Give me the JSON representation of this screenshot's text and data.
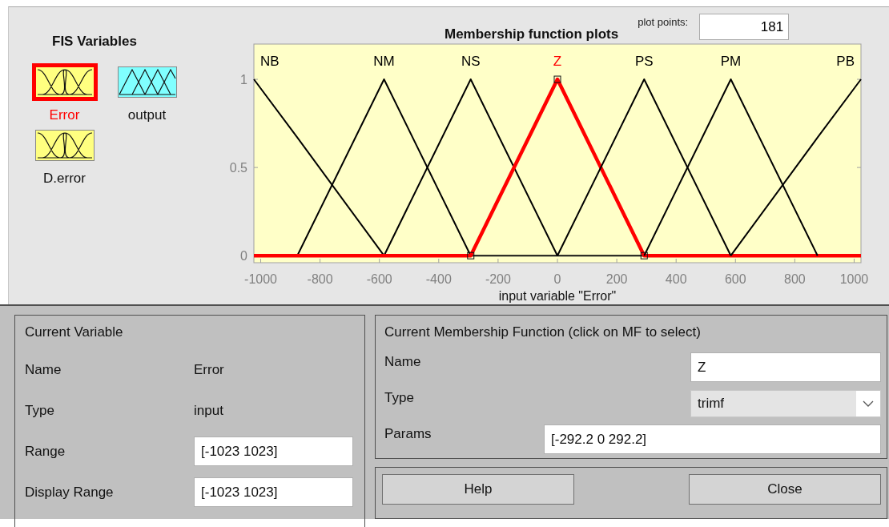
{
  "fis_variables": {
    "title": "FIS Variables",
    "items": [
      {
        "name": "Error",
        "kind": "input",
        "selected": true
      },
      {
        "name": "output",
        "kind": "output",
        "selected": false
      },
      {
        "name": "D.error",
        "kind": "input",
        "selected": false
      }
    ]
  },
  "plot": {
    "plot_points_label": "plot points:",
    "plot_points": "181",
    "membership_functions": [
      {
        "selected": false
      },
      {
        "selected": false
      },
      {
        "selected": false
      },
      {
        "selected": true
      },
      {
        "selected": false
      },
      {
        "selected": false
      },
      {
        "selected": false
      }
    ],
    "chart_data": {
      "type": "line",
      "title": "Membership function plots",
      "xlabel": "input variable \"Error\"",
      "x": [
        -1023,
        -876.6,
        -584.4,
        -292.2,
        0,
        292.2,
        584.4,
        876.6,
        1023
      ],
      "series": [
        {
          "name": "NB",
          "color": "#000000",
          "values": [
            1,
            0.67,
            0,
            null,
            null,
            null,
            null,
            null,
            null
          ]
        },
        {
          "name": "NM",
          "color": "#000000",
          "values": [
            null,
            0,
            1,
            0,
            null,
            null,
            null,
            null,
            null
          ]
        },
        {
          "name": "NS",
          "color": "#000000",
          "values": [
            null,
            null,
            0,
            1,
            0,
            null,
            null,
            null,
            null
          ]
        },
        {
          "name": "Z",
          "color": "#ff0000",
          "values": [
            0,
            0,
            0,
            0,
            1,
            0,
            0,
            0,
            0
          ]
        },
        {
          "name": "PS",
          "color": "#000000",
          "values": [
            null,
            null,
            null,
            null,
            0,
            1,
            0,
            null,
            null
          ]
        },
        {
          "name": "PM",
          "color": "#000000",
          "values": [
            null,
            null,
            null,
            null,
            null,
            0,
            1,
            0,
            null
          ]
        },
        {
          "name": "PB",
          "color": "#000000",
          "values": [
            null,
            null,
            null,
            null,
            null,
            null,
            0,
            0.67,
            1
          ]
        }
      ],
      "legend": "inside-top",
      "xlim": [
        -1023,
        1023
      ],
      "ylim": [
        -0.04,
        1.2
      ],
      "xticks": [
        -1000,
        -800,
        -600,
        -400,
        -200,
        0,
        200,
        400,
        600,
        800,
        1000
      ],
      "yticks": [
        0,
        0.5,
        1
      ]
    }
  },
  "current_variable": {
    "title": "Current Variable",
    "rows": [
      {
        "label": "Name",
        "value": "Error",
        "kind": "text"
      },
      {
        "label": "Type",
        "value": "input",
        "kind": "text"
      },
      {
        "label": "Range",
        "value": "[-1023 1023]",
        "kind": "field"
      },
      {
        "label": "Display Range",
        "value": "[-1023 1023]",
        "kind": "field"
      }
    ]
  },
  "current_mf": {
    "title": "Current Membership Function (click on MF to select)",
    "rows": [
      {
        "label": "Name",
        "value": "Z",
        "kind": "field"
      },
      {
        "label": "Type",
        "value": "trimf",
        "kind": "dropdown"
      },
      {
        "label": "Params",
        "value": "[-292.2 0 292.2]",
        "kind": "wide_field"
      }
    ]
  },
  "buttons": [
    "Help",
    "Close"
  ]
}
